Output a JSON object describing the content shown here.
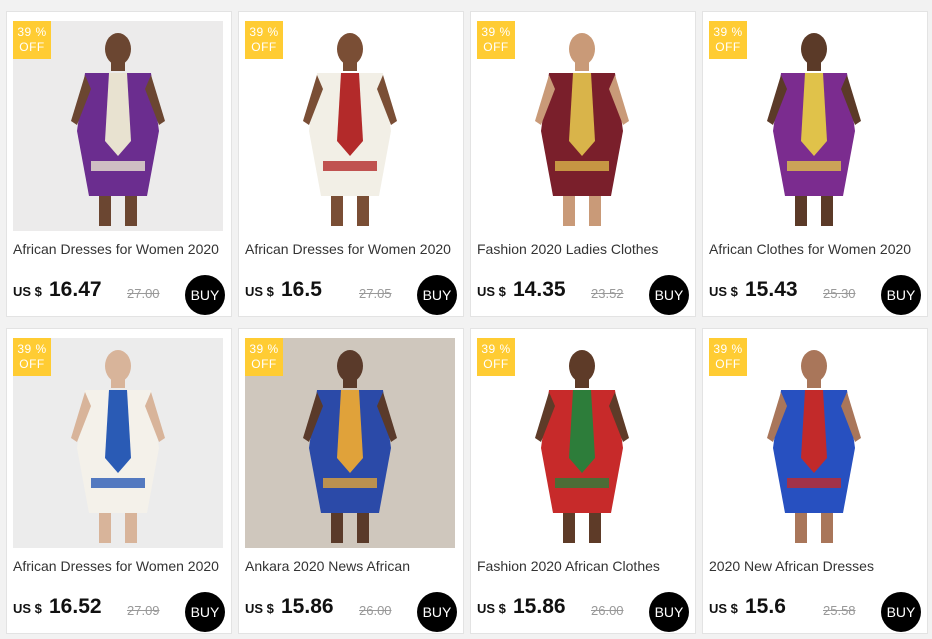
{
  "products": [
    {
      "badge_pct": "39 %",
      "badge_off": "OFF",
      "title": "African Dresses for Women 2020",
      "currency": "US $",
      "price": "16.47",
      "old_price": "27.00",
      "buy_label": "BUY",
      "image_icon": "dress-photo-icon",
      "colors": {
        "bg": "#ecebeb",
        "main": "#6b2d8f",
        "accent": "#e8e2d0",
        "skin": "#6b4631"
      }
    },
    {
      "badge_pct": "39 %",
      "badge_off": "OFF",
      "title": "African Dresses for Women 2020",
      "currency": "US $",
      "price": "16.5",
      "old_price": "27.05",
      "buy_label": "BUY",
      "image_icon": "dress-photo-icon",
      "colors": {
        "bg": "#ffffff",
        "main": "#f2efe6",
        "accent": "#b32a2a",
        "skin": "#7a4e35"
      }
    },
    {
      "badge_pct": "39 %",
      "badge_off": "OFF",
      "title": "Fashion 2020 Ladies Clothes",
      "currency": "US $",
      "price": "14.35",
      "old_price": "23.52",
      "buy_label": "BUY",
      "image_icon": "top-photo-icon",
      "colors": {
        "bg": "#ffffff",
        "main": "#7a1f2b",
        "accent": "#d9b44a",
        "skin": "#c99a78"
      }
    },
    {
      "badge_pct": "39 %",
      "badge_off": "OFF",
      "title": "African Clothes for Women 2020",
      "currency": "US $",
      "price": "15.43",
      "old_price": "25.30",
      "buy_label": "BUY",
      "image_icon": "dress-photo-icon",
      "colors": {
        "bg": "#ffffff",
        "main": "#7b2c8f",
        "accent": "#e0c24a",
        "skin": "#5b3a28"
      }
    },
    {
      "badge_pct": "39 %",
      "badge_off": "OFF",
      "title": "African Dresses for Women 2020",
      "currency": "US $",
      "price": "16.52",
      "old_price": "27.09",
      "buy_label": "BUY",
      "image_icon": "dress-photo-icon",
      "colors": {
        "bg": "#ececec",
        "main": "#f4f1ea",
        "accent": "#2a5bb5",
        "skin": "#d8b49a"
      }
    },
    {
      "badge_pct": "39 %",
      "badge_off": "OFF",
      "title": "Ankara 2020 News African",
      "currency": "US $",
      "price": "15.86",
      "old_price": "26.00",
      "buy_label": "BUY",
      "image_icon": "dress-photo-icon",
      "colors": {
        "bg": "#cfc7bd",
        "main": "#2b4aa8",
        "accent": "#e0a23a",
        "skin": "#5a3a2a"
      }
    },
    {
      "badge_pct": "39 %",
      "badge_off": "OFF",
      "title": "Fashion 2020 African Clothes",
      "currency": "US $",
      "price": "15.86",
      "old_price": "26.00",
      "buy_label": "BUY",
      "image_icon": "hoodie-photo-icon",
      "colors": {
        "bg": "#ffffff",
        "main": "#c72a2a",
        "accent": "#2d7d3a",
        "skin": "#5e3b28"
      }
    },
    {
      "badge_pct": "39 %",
      "badge_off": "OFF",
      "title": "2020 New African Dresses",
      "currency": "US $",
      "price": "15.6",
      "old_price": "25.58",
      "buy_label": "BUY",
      "image_icon": "dress-photo-icon",
      "colors": {
        "bg": "#ffffff",
        "main": "#2750c0",
        "accent": "#c22a2a",
        "skin": "#a9765a"
      }
    }
  ]
}
